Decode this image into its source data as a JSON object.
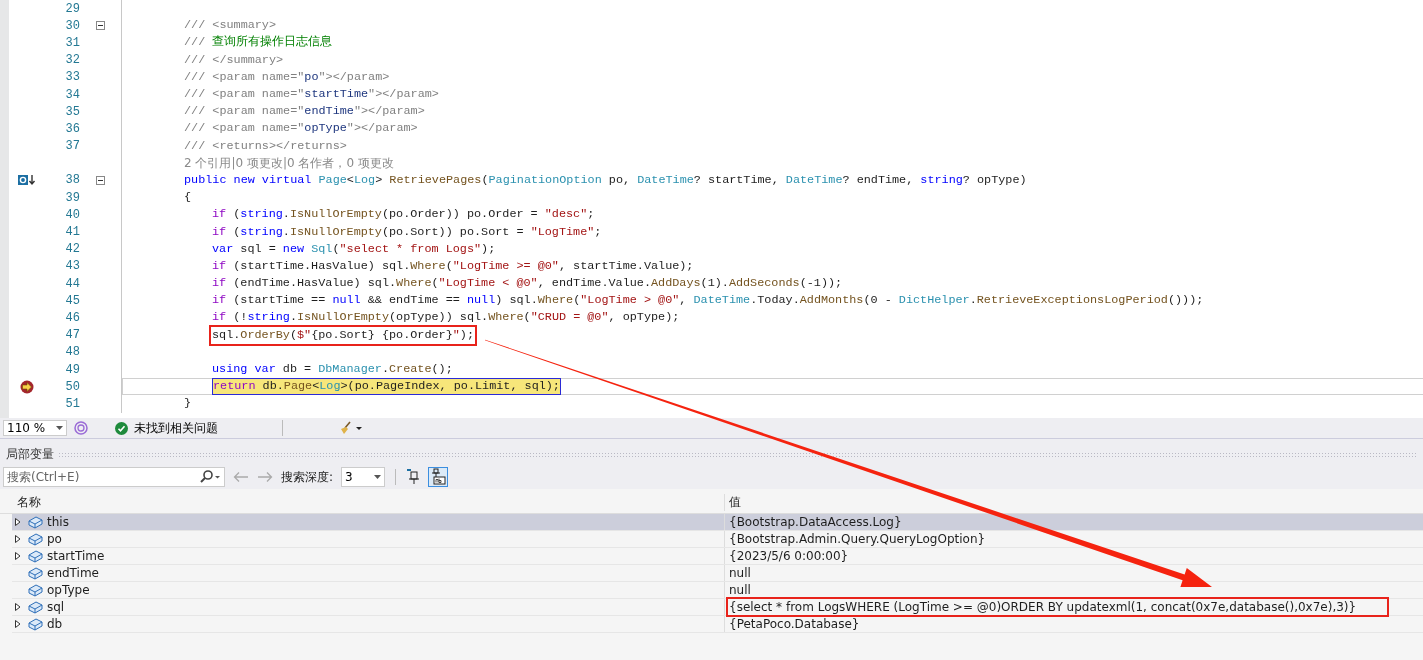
{
  "editor": {
    "lines": [
      {
        "number": "29"
      },
      {
        "number": "30",
        "fold": true,
        "tokens": [
          {
            "kind": "doc",
            "t": "/// <summary>"
          }
        ]
      },
      {
        "number": "31",
        "tokens": [
          {
            "kind": "doc",
            "t": "/// "
          },
          {
            "kind": "cm",
            "t": "查询所有操作日志信息"
          }
        ]
      },
      {
        "number": "32",
        "tokens": [
          {
            "kind": "doc",
            "t": "/// </summary>"
          }
        ]
      },
      {
        "number": "33",
        "tokens": [
          {
            "kind": "doc",
            "t": "/// <param name=\""
          },
          {
            "kind": "dn",
            "t": "po"
          },
          {
            "kind": "doc",
            "t": "\"></param>"
          }
        ]
      },
      {
        "number": "34",
        "tokens": [
          {
            "kind": "doc",
            "t": "/// <param name=\""
          },
          {
            "kind": "dn",
            "t": "startTime"
          },
          {
            "kind": "doc",
            "t": "\"></param>"
          }
        ]
      },
      {
        "number": "35",
        "tokens": [
          {
            "kind": "doc",
            "t": "/// <param name=\""
          },
          {
            "kind": "dn",
            "t": "endTime"
          },
          {
            "kind": "doc",
            "t": "\"></param>"
          }
        ]
      },
      {
        "number": "36",
        "tokens": [
          {
            "kind": "doc",
            "t": "/// <param name=\""
          },
          {
            "kind": "dn",
            "t": "opType"
          },
          {
            "kind": "doc",
            "t": "\"></param>"
          }
        ]
      },
      {
        "number": "37",
        "tokens": [
          {
            "kind": "doc",
            "t": "/// <returns></returns>"
          }
        ]
      },
      {
        "kind": "lens",
        "text": "2 个引用|0 项更改|0 名作者，0 项更改"
      },
      {
        "number": "38",
        "fold": true,
        "override": true,
        "tokens": [
          {
            "kind": "kw",
            "t": "public new virtual "
          },
          {
            "kind": "type",
            "t": "Page"
          },
          {
            "kind": "p",
            "t": "<"
          },
          {
            "kind": "type",
            "t": "Log"
          },
          {
            "kind": "p",
            "t": "> "
          },
          {
            "kind": "m",
            "t": "RetrievePages"
          },
          {
            "kind": "p",
            "t": "("
          },
          {
            "kind": "type",
            "t": "PaginationOption"
          },
          {
            "kind": "p",
            "t": " po, "
          },
          {
            "kind": "type",
            "t": "DateTime"
          },
          {
            "kind": "p",
            "t": "? startTime, "
          },
          {
            "kind": "type",
            "t": "DateTime"
          },
          {
            "kind": "p",
            "t": "? endTime, "
          },
          {
            "kind": "kw",
            "t": "string"
          },
          {
            "kind": "p",
            "t": "? opType)"
          }
        ]
      },
      {
        "number": "39",
        "tokens": [
          {
            "kind": "p",
            "t": "{"
          }
        ],
        "children": [
          {
            "number": "40",
            "tokens": [
              {
                "kind": "ctl",
                "t": "if"
              },
              {
                "kind": "p",
                "t": " ("
              },
              {
                "kind": "kw",
                "t": "string"
              },
              {
                "kind": "p",
                "t": "."
              },
              {
                "kind": "m",
                "t": "IsNullOrEmpty"
              },
              {
                "kind": "p",
                "t": "(po.Order)) po.Order = "
              },
              {
                "kind": "str",
                "t": "\"desc\""
              },
              {
                "kind": "p",
                "t": ";"
              }
            ]
          },
          {
            "number": "41",
            "tokens": [
              {
                "kind": "ctl",
                "t": "if"
              },
              {
                "kind": "p",
                "t": " ("
              },
              {
                "kind": "kw",
                "t": "string"
              },
              {
                "kind": "p",
                "t": "."
              },
              {
                "kind": "m",
                "t": "IsNullOrEmpty"
              },
              {
                "kind": "p",
                "t": "(po.Sort)) po.Sort = "
              },
              {
                "kind": "str",
                "t": "\"LogTime\""
              },
              {
                "kind": "p",
                "t": ";"
              }
            ]
          },
          {
            "number": "42",
            "tokens": [
              {
                "kind": "kw",
                "t": "var"
              },
              {
                "kind": "p",
                "t": " sql = "
              },
              {
                "kind": "kw",
                "t": "new"
              },
              {
                "kind": "type",
                "t": " Sql"
              },
              {
                "kind": "p",
                "t": "("
              },
              {
                "kind": "str",
                "t": "\"select * from Logs\""
              },
              {
                "kind": "p",
                "t": ");"
              }
            ]
          },
          {
            "number": "43",
            "tokens": [
              {
                "kind": "ctl",
                "t": "if"
              },
              {
                "kind": "p",
                "t": " (startTime.HasValue) sql."
              },
              {
                "kind": "m",
                "t": "Where"
              },
              {
                "kind": "p",
                "t": "("
              },
              {
                "kind": "str",
                "t": "\"LogTime >= @0\""
              },
              {
                "kind": "p",
                "t": ", startTime.Value);"
              }
            ]
          },
          {
            "number": "44",
            "tokens": [
              {
                "kind": "ctl",
                "t": "if"
              },
              {
                "kind": "p",
                "t": " (endTime.HasValue) sql."
              },
              {
                "kind": "m",
                "t": "Where"
              },
              {
                "kind": "p",
                "t": "("
              },
              {
                "kind": "str",
                "t": "\"LogTime < @0\""
              },
              {
                "kind": "p",
                "t": ", endTime.Value."
              },
              {
                "kind": "m",
                "t": "AddDays"
              },
              {
                "kind": "p",
                "t": "(1)."
              },
              {
                "kind": "m",
                "t": "AddSeconds"
              },
              {
                "kind": "p",
                "t": "(-1));"
              }
            ]
          },
          {
            "number": "45",
            "tokens": [
              {
                "kind": "ctl",
                "t": "if"
              },
              {
                "kind": "p",
                "t": " (startTime == "
              },
              {
                "kind": "kw",
                "t": "null"
              },
              {
                "kind": "p",
                "t": " && endTime == "
              },
              {
                "kind": "kw",
                "t": "null"
              },
              {
                "kind": "p",
                "t": ") sql."
              },
              {
                "kind": "m",
                "t": "Where"
              },
              {
                "kind": "p",
                "t": "("
              },
              {
                "kind": "str",
                "t": "\"LogTime > @0\""
              },
              {
                "kind": "p",
                "t": ", "
              },
              {
                "kind": "type",
                "t": "DateTime"
              },
              {
                "kind": "p",
                "t": ".Today."
              },
              {
                "kind": "m",
                "t": "AddMonths"
              },
              {
                "kind": "p",
                "t": "(0 - "
              },
              {
                "kind": "type",
                "t": "DictHelper"
              },
              {
                "kind": "p",
                "t": "."
              },
              {
                "kind": "m",
                "t": "RetrieveExceptionsLogPeriod"
              },
              {
                "kind": "p",
                "t": "()));"
              }
            ]
          },
          {
            "number": "46",
            "tokens": [
              {
                "kind": "ctl",
                "t": "if"
              },
              {
                "kind": "p",
                "t": " (!"
              },
              {
                "kind": "kw",
                "t": "string"
              },
              {
                "kind": "p",
                "t": "."
              },
              {
                "kind": "m",
                "t": "IsNullOrEmpty"
              },
              {
                "kind": "p",
                "t": "(opType)) sql."
              },
              {
                "kind": "m",
                "t": "Where"
              },
              {
                "kind": "p",
                "t": "("
              },
              {
                "kind": "str",
                "t": "\"CRUD = @0\""
              },
              {
                "kind": "p",
                "t": ", opType);"
              }
            ]
          },
          {
            "number": "47",
            "annotated": true,
            "tokens": [
              {
                "kind": "p",
                "t": "sql."
              },
              {
                "kind": "m",
                "t": "OrderBy"
              },
              {
                "kind": "p",
                "t": "("
              },
              {
                "kind": "str",
                "t": "$\""
              },
              {
                "kind": "p",
                "t": "{po.Sort} {po.Order}"
              },
              {
                "kind": "str",
                "t": "\""
              },
              {
                "kind": "p",
                "t": ");"
              }
            ]
          },
          {
            "number": "48"
          },
          {
            "number": "49",
            "tokens": [
              {
                "kind": "kw",
                "t": "using var"
              },
              {
                "kind": "p",
                "t": " db = "
              },
              {
                "kind": "type",
                "t": "DbManager"
              },
              {
                "kind": "p",
                "t": "."
              },
              {
                "kind": "m",
                "t": "Create"
              },
              {
                "kind": "p",
                "t": "();"
              }
            ]
          },
          {
            "number": "50",
            "current": true,
            "breakpoint": true,
            "tokens": [
              {
                "kind": "ctl",
                "t": "return"
              },
              {
                "kind": "p",
                "t": " db."
              },
              {
                "kind": "m",
                "t": "Page"
              },
              {
                "kind": "p",
                "t": "<"
              },
              {
                "kind": "type",
                "t": "Log"
              },
              {
                "kind": "p",
                "t": ">(po.PageIndex, po.Limit, sql);"
              }
            ]
          }
        ]
      },
      {
        "number": "51",
        "tokens": [
          {
            "kind": "p",
            "t": "}"
          }
        ]
      }
    ]
  },
  "status": {
    "zoom": "110 %",
    "issues": "未找到相关问题"
  },
  "locals": {
    "title": "局部变量",
    "search": {
      "placeholder": "搜索(Ctrl+E)"
    },
    "depth_label": "搜索深度:",
    "depth": "3",
    "columns": [
      "名称",
      "值"
    ],
    "rows": [
      {
        "name": "this",
        "value": "{Bootstrap.DataAccess.Log}",
        "expandable": true,
        "selected": true,
        "annotated": false
      },
      {
        "name": "po",
        "value": "{Bootstrap.Admin.Query.QueryLogOption}",
        "expandable": true,
        "selected": false,
        "annotated": false
      },
      {
        "name": "startTime",
        "value": "{2023/5/6 0:00:00}",
        "expandable": true,
        "selected": false,
        "annotated": false
      },
      {
        "name": "endTime",
        "value": "null",
        "expandable": false,
        "selected": false,
        "annotated": false
      },
      {
        "name": "opType",
        "value": "null",
        "expandable": false,
        "selected": false,
        "annotated": false
      },
      {
        "name": "sql",
        "value": "{select * from LogsWHERE (LogTime >= @0)ORDER BY updatexml(1, concat(0x7e,database(),0x7e),3)}",
        "expandable": true,
        "selected": false,
        "annotated": true
      },
      {
        "name": "db",
        "value": "{PetaPoco.Database}",
        "expandable": true,
        "selected": false,
        "annotated": false
      }
    ]
  }
}
